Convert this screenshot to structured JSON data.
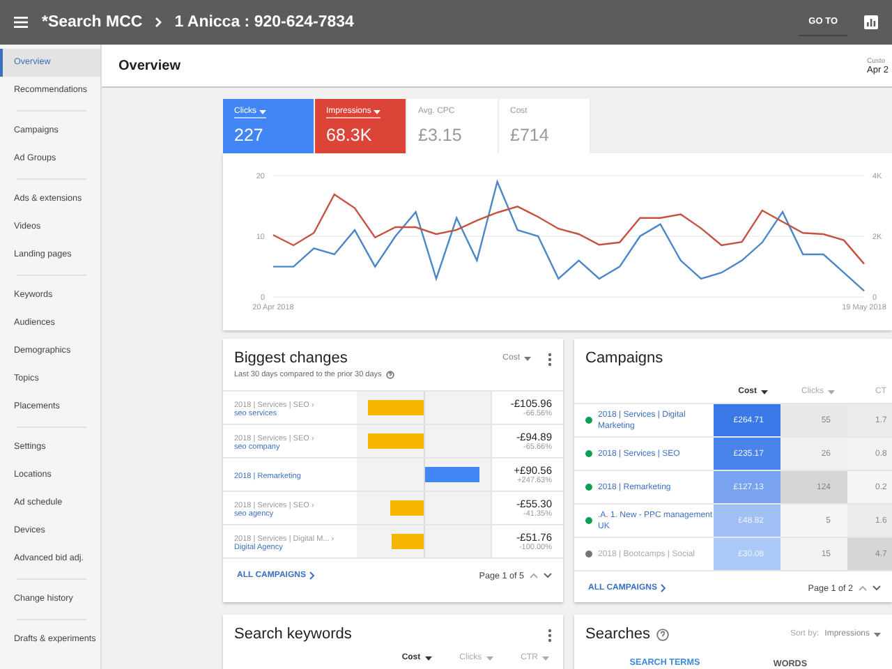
{
  "topbar": {
    "breadcrumb": [
      "*Search MCC",
      "1 Anicca : 920-624-7834"
    ],
    "goto_button": "GO TO"
  },
  "sidebar": {
    "groups": [
      {
        "items": [
          {
            "label": "Overview",
            "selected": true
          },
          {
            "label": "Recommendations",
            "selected": false
          }
        ]
      },
      {
        "items": [
          {
            "label": "Campaigns",
            "selected": false
          },
          {
            "label": "Ad Groups",
            "selected": false
          }
        ]
      },
      {
        "items": [
          {
            "label": "Ads & extensions",
            "selected": false
          },
          {
            "label": "Videos",
            "selected": false
          },
          {
            "label": "Landing pages",
            "selected": false
          }
        ]
      },
      {
        "items": [
          {
            "label": "Keywords",
            "selected": false
          },
          {
            "label": "Audiences",
            "selected": false
          },
          {
            "label": "Demographics",
            "selected": false
          },
          {
            "label": "Topics",
            "selected": false
          },
          {
            "label": "Placements",
            "selected": false
          }
        ]
      },
      {
        "items": [
          {
            "label": "Settings",
            "selected": false
          },
          {
            "label": "Locations",
            "selected": false
          },
          {
            "label": "Ad schedule",
            "selected": false
          },
          {
            "label": "Devices",
            "selected": false
          },
          {
            "label": "Advanced bid adj.",
            "selected": false
          }
        ]
      },
      {
        "items": [
          {
            "label": "Change history",
            "selected": false
          }
        ]
      },
      {
        "items": [
          {
            "label": "Drafts & experiments",
            "selected": false
          }
        ]
      }
    ]
  },
  "header": {
    "title": "Overview",
    "date_label": "Custo",
    "date_value": "Apr 2"
  },
  "metrics": [
    {
      "label": "Clicks",
      "value": "227",
      "selected": true,
      "color": "#4285f4"
    },
    {
      "label": "Impressions",
      "value": "68.3K",
      "selected": true,
      "color": "#db4437"
    },
    {
      "label": "Avg. CPC",
      "value": "£3.15",
      "selected": false
    },
    {
      "label": "Cost",
      "value": "£714",
      "selected": false
    }
  ],
  "chart": {
    "chart_data": {
      "type": "line",
      "categories": [
        "20 Apr 2018",
        null,
        null,
        null,
        null,
        null,
        null,
        null,
        null,
        null,
        null,
        null,
        null,
        null,
        null,
        null,
        null,
        null,
        null,
        null,
        null,
        null,
        null,
        null,
        null,
        null,
        null,
        null,
        null,
        "19 May 2018"
      ],
      "ylim": [
        0,
        20
      ],
      "yticks": [
        0,
        10,
        20
      ],
      "y2lim": [
        0,
        4000
      ],
      "y2ticks": [
        {
          "value": 0,
          "label": "0"
        },
        {
          "value": 2000,
          "label": "2K"
        },
        {
          "value": 4000,
          "label": "4K"
        }
      ],
      "series": [
        {
          "color": "#4a86c8",
          "axis": "y",
          "values": [
            5,
            5,
            8,
            7,
            11,
            5,
            10,
            14,
            3,
            13,
            6,
            19,
            11,
            10,
            3,
            6,
            3,
            5,
            10,
            12,
            6,
            3,
            4,
            6,
            9,
            14,
            7,
            7,
            4,
            1
          ]
        },
        {
          "color": "#c5523f",
          "axis": "y2",
          "values": [
            2040,
            1700,
            2110,
            3380,
            2930,
            1960,
            2300,
            2300,
            2070,
            2210,
            2520,
            2780,
            2980,
            2640,
            2250,
            2070,
            1720,
            1800,
            2600,
            2600,
            2720,
            2260,
            1700,
            1810,
            2850,
            2480,
            2110,
            2070,
            1870,
            1090
          ]
        }
      ]
    }
  },
  "biggest_changes": {
    "title": "Biggest changes",
    "subtitle": "Last 30 days compared to the prior 30 days",
    "sort": "Cost",
    "rows": [
      {
        "path": "2018 | Services | SEO ›",
        "name": "seo services",
        "kind": "decrease",
        "level": 0.83,
        "value": "-£105.96",
        "percent": "-66.56%"
      },
      {
        "path": "2018 | Services | SEO ›",
        "name": "seo company",
        "kind": "decrease",
        "level": 0.83,
        "value": "-£94.89",
        "percent": "-65.66%"
      },
      {
        "name": "2018 | Remarketing",
        "kind": "increase",
        "level": 0.83,
        "value": "+£90.56",
        "percent": "+247.63%"
      },
      {
        "path": "2018 | Services | SEO ›",
        "name": "seo agency",
        "kind": "decrease",
        "level": 0.5,
        "value": "-£55.30",
        "percent": "-41.35%"
      },
      {
        "path": "2018 | Services | Digital M... ›",
        "name": "Digital Agency",
        "kind": "decrease",
        "level": 0.47,
        "value": "-£51.76",
        "percent": "-100.00%"
      }
    ],
    "link": "ALL CAMPAIGNS",
    "page": "Page 1 of 5"
  },
  "campaigns": {
    "title": "Campaigns",
    "columns": [
      "Cost",
      "Clicks",
      "CT"
    ],
    "rows": [
      {
        "name": "2018 | Services | Digital Marketing",
        "color": "#0f9d58",
        "paused": false,
        "cells": [
          {
            "text": "£264.71",
            "color": "#3b78e7"
          },
          {
            "text": "55",
            "color": "#e8e8e8"
          },
          {
            "text": "1.7",
            "color": "#ececec"
          }
        ]
      },
      {
        "name": "2018 | Services | SEO",
        "color": "#0f9d58",
        "paused": false,
        "cells": [
          {
            "text": "£235.17",
            "color": "#4a83ea"
          },
          {
            "text": "26",
            "color": "#f0f0f0"
          },
          {
            "text": "0.8",
            "color": "#f2f2f2"
          }
        ]
      },
      {
        "name": "2018 | Remarketing",
        "color": "#0f9d58",
        "paused": false,
        "cells": [
          {
            "text": "£127.13",
            "color": "#79a3f0"
          },
          {
            "text": "124",
            "color": "#d6d6d6"
          },
          {
            "text": "0.2",
            "color": "#f5f5f5"
          }
        ]
      },
      {
        "name": ".A. 1. New - PPC management UK",
        "color": "#0f9d58",
        "paused": false,
        "cells": [
          {
            "text": "£48.82",
            "color": "#a0bff5"
          },
          {
            "text": "5",
            "color": "#f5f5f5"
          },
          {
            "text": "1.6",
            "color": "#ececec"
          }
        ]
      },
      {
        "name": "2018 | Bootcamps | Social",
        "color": "#757575",
        "paused": true,
        "cells": [
          {
            "text": "£30.08",
            "color": "#acc8f7"
          },
          {
            "text": "15",
            "color": "#f2f2f2"
          },
          {
            "text": "4.7",
            "color": "#d6d6d6"
          }
        ]
      }
    ],
    "link": "ALL CAMPAIGNS",
    "page": "Page 1 of 2"
  },
  "search_keywords": {
    "title": "Search keywords",
    "columns": [
      {
        "label": "Cost",
        "selected": true
      },
      {
        "label": "Clicks",
        "selected": false
      },
      {
        "label": "CTR",
        "selected": false
      }
    ]
  },
  "searches": {
    "title": "Searches",
    "sort_label": "Sort by:",
    "sort_value": "Impressions",
    "tabs": [
      {
        "label": "SEARCH TERMS",
        "selected": true
      },
      {
        "label": "WORDS",
        "selected": false
      }
    ]
  }
}
